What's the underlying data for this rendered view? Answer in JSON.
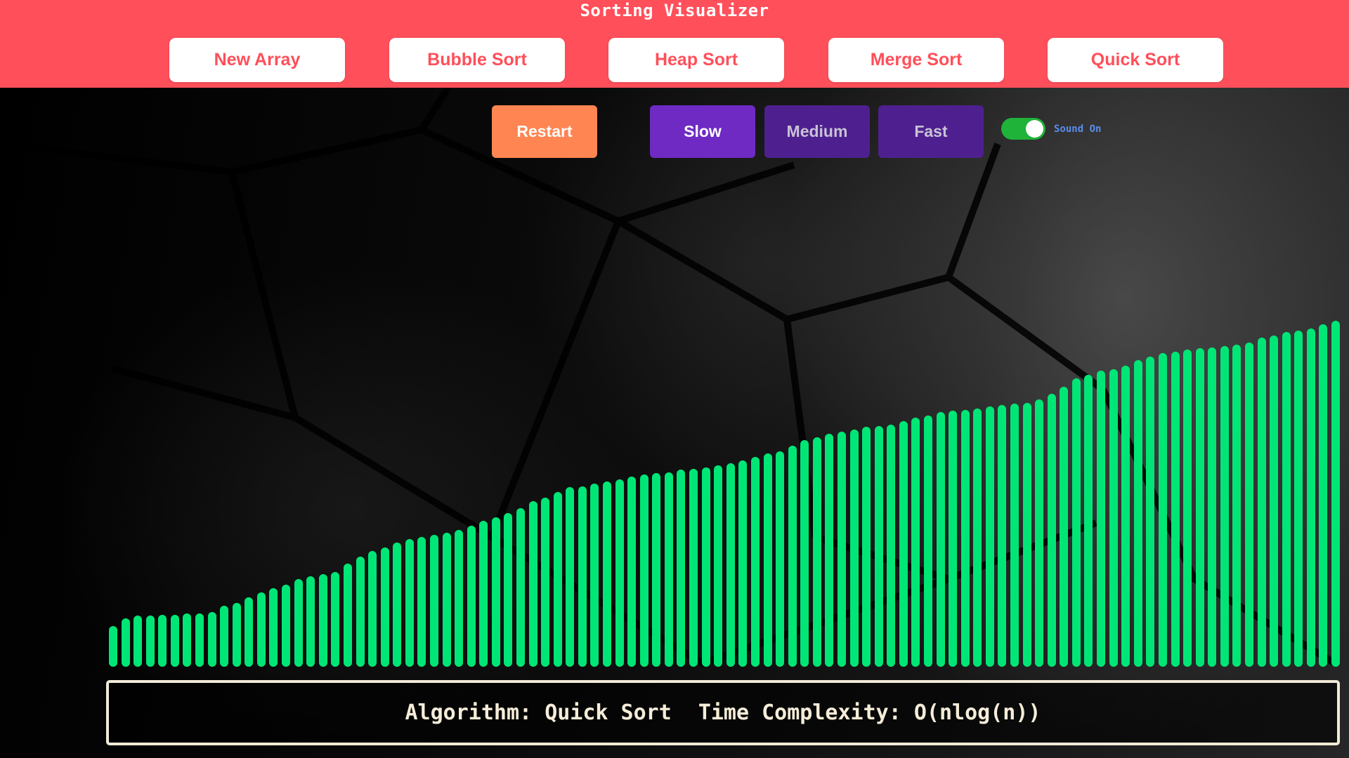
{
  "header": {
    "title": "Sorting Visualizer",
    "buttons": [
      "New Array",
      "Bubble Sort",
      "Heap Sort",
      "Merge Sort",
      "Quick Sort"
    ]
  },
  "controls": {
    "restart": "Restart",
    "speeds": [
      "Slow",
      "Medium",
      "Fast"
    ],
    "selected_speed": "Slow",
    "sound_on": true,
    "sound_label": "Sound On"
  },
  "colors": {
    "header": "#ff4f5a",
    "bar": "#00e676",
    "restart": "#ff8552",
    "speed_active": "#6f2ac4",
    "speed_inactive": "#4e208f",
    "toggle": "#1fb33a"
  },
  "info": {
    "algorithm_label": "Algorithm:",
    "algorithm": "Quick Sort",
    "complexity_label": "Time Complexity:",
    "complexity": "O(nlog(n))"
  },
  "array_values": [
    35,
    42,
    44,
    44,
    45,
    45,
    46,
    46,
    47,
    53,
    55,
    60,
    64,
    68,
    71,
    76,
    78,
    80,
    82,
    89,
    95,
    100,
    103,
    107,
    110,
    112,
    114,
    116,
    118,
    122,
    126,
    129,
    133,
    137,
    143,
    146,
    151,
    155,
    156,
    158,
    160,
    162,
    164,
    166,
    167,
    168,
    170,
    171,
    172,
    174,
    176,
    178,
    181,
    184,
    186,
    191,
    196,
    198,
    201,
    203,
    205,
    207,
    208,
    209,
    212,
    215,
    217,
    220,
    221,
    222,
    223,
    225,
    226,
    227,
    228,
    231,
    236,
    242,
    249,
    252,
    256,
    257,
    260,
    265,
    268,
    271,
    272,
    274,
    275,
    276,
    277,
    278,
    280,
    284,
    286,
    289,
    290,
    292,
    296,
    299
  ]
}
